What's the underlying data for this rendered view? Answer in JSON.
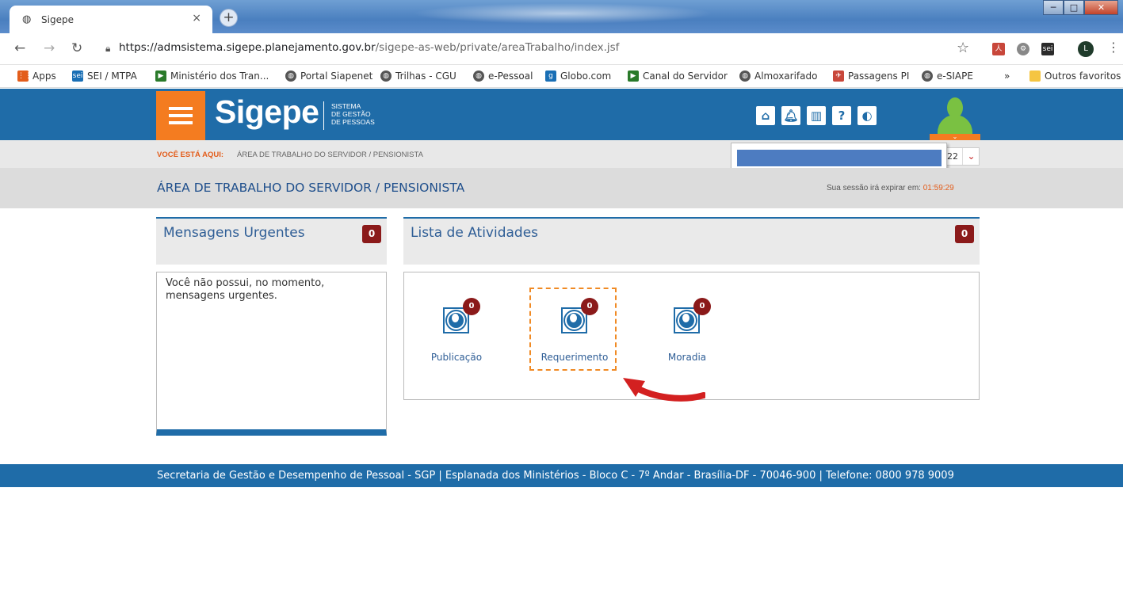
{
  "browser": {
    "tab_title": "Sigepe",
    "tab_close": "×",
    "new_tab": "+",
    "url_host": "https://admsistema.sigepe.planejamento.gov.br",
    "url_path": "/sigepe-as-web/private/areaTrabalho/index.jsf",
    "profile_initial": "L",
    "window_controls": {
      "minimize": "─",
      "maximize": "□",
      "close": "✕"
    },
    "bookmarks": [
      {
        "label": "Apps",
        "icon": "apps-grid-icon"
      },
      {
        "label": "SEI / MTPA",
        "icon": "sei-icon"
      },
      {
        "label": "Ministério dos Tran...",
        "icon": "ministry-icon"
      },
      {
        "label": "Portal Siapenet",
        "icon": "globe-icon"
      },
      {
        "label": "Trilhas - CGU",
        "icon": "globe-icon"
      },
      {
        "label": "e-Pessoal",
        "icon": "globe-icon"
      },
      {
        "label": "Globo.com",
        "icon": "globo-icon"
      },
      {
        "label": "Canal do Servidor",
        "icon": "ministry-icon"
      },
      {
        "label": "Almoxarifado",
        "icon": "globe-icon"
      },
      {
        "label": "Passagens PI",
        "icon": "plane-icon"
      },
      {
        "label": "e-SIAPE",
        "icon": "globe-icon"
      }
    ],
    "bookmarks_more": "»",
    "other_bookmarks": "Outros favoritos"
  },
  "header": {
    "brand": "Sigepe",
    "brand_sub": [
      "SISTEMA",
      "DE GESTÃO",
      "DE PESSOAS"
    ],
    "icons": [
      "home-icon",
      "bell-icon",
      "book-icon",
      "help-icon",
      "contrast-icon"
    ]
  },
  "breadcrumb": {
    "label": "VOCÊ ESTÁ AQUI:",
    "value": "ÁREA DE TRABALHO DO SERVIDOR / PENSIONISTA",
    "select_tail": "22"
  },
  "page": {
    "title": "ÁREA DE TRABALHO DO SERVIDOR / PENSIONISTA",
    "session_text": "Sua sessão irá expirar em:",
    "session_time": "01:59:29"
  },
  "urgent": {
    "title": "Mensagens Urgentes",
    "count": "0",
    "empty_text": "Você não possui, no momento, mensagens urgentes."
  },
  "activities": {
    "title": "Lista de Atividades",
    "count": "0",
    "items": [
      {
        "label": "Publicação",
        "badge": "0"
      },
      {
        "label": "Requerimento",
        "badge": "0"
      },
      {
        "label": "Moradia",
        "badge": "0"
      }
    ]
  },
  "footer": {
    "text": "Secretaria de Gestão e Desempenho de Pessoal - SGP | Esplanada dos Ministérios - Bloco C - 7º Andar - Brasília-DF - 70046-900 | Telefone: 0800 978 9009"
  },
  "colors": {
    "primary_blue": "#1f6ca8",
    "accent_orange": "#f47c20",
    "badge_red": "#8b1a1a",
    "annotation_red": "#d32020"
  }
}
